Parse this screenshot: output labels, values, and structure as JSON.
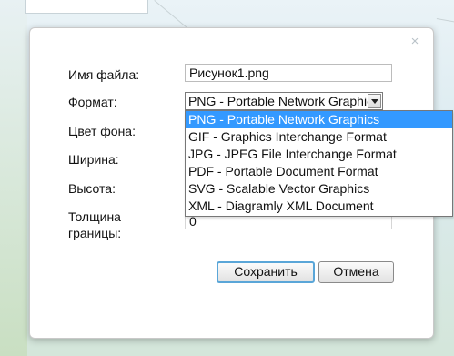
{
  "dialog": {
    "close_glyph": "×",
    "labels": {
      "filename": "Имя файла:",
      "format": "Формат:",
      "bg_color": "Цвет фона:",
      "width": "Ширина:",
      "height": "Высота:",
      "border_line1": "Толщина",
      "border_line2": "границы:"
    },
    "filename_value": "Рисунок1.png",
    "format_selected": "PNG - Portable Network Graphics",
    "format_options": [
      "PNG - Portable Network Graphics",
      "GIF - Graphics Interchange Format",
      "JPG - JPEG File Interchange Format",
      "PDF - Portable Document Format",
      "SVG - Scalable Vector Graphics",
      "XML - Diagramly XML Document"
    ],
    "border_value": "0",
    "save_label": "Сохранить",
    "cancel_label": "Отмена"
  },
  "colors": {
    "selected_option_bg": "#3399ff",
    "primary_button_border": "#5aa6d8"
  }
}
